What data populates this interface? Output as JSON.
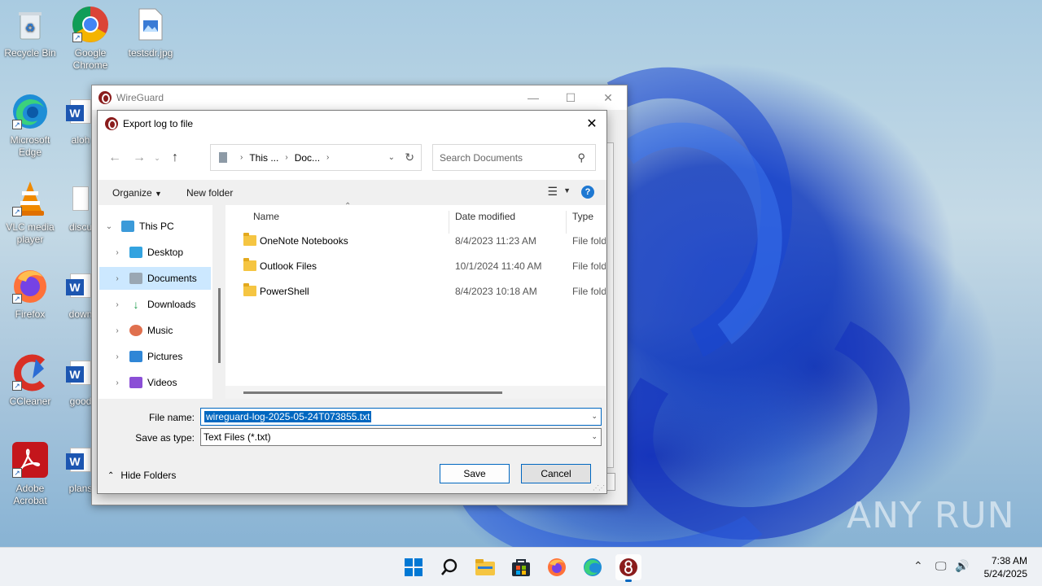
{
  "desktop": {
    "icons": [
      {
        "label": "Recycle Bin",
        "icon": "recycle-bin-icon"
      },
      {
        "label": "Google Chrome",
        "icon": "chrome-icon"
      },
      {
        "label": "testsdr.jpg",
        "icon": "image-file-icon"
      },
      {
        "label": "Microsoft Edge",
        "icon": "edge-icon"
      },
      {
        "label": "aloh",
        "icon": "word-doc-icon"
      },
      {
        "label": "VLC media player",
        "icon": "vlc-icon"
      },
      {
        "label": "discu",
        "icon": "word-doc-icon"
      },
      {
        "label": "Firefox",
        "icon": "firefox-icon"
      },
      {
        "label": "down",
        "icon": "word-doc-icon"
      },
      {
        "label": "CCleaner",
        "icon": "ccleaner-icon"
      },
      {
        "label": "good",
        "icon": "word-doc-icon"
      },
      {
        "label": "Adobe Acrobat",
        "icon": "acrobat-icon"
      },
      {
        "label": "plans",
        "icon": "word-doc-icon"
      }
    ]
  },
  "wireguard_window": {
    "title": "WireGuard"
  },
  "dialog": {
    "title": "Export log to file",
    "address": {
      "crumbs": [
        "This ...",
        "Doc..."
      ]
    },
    "search_placeholder": "Search Documents",
    "toolbar": {
      "organize": "Organize",
      "new_folder": "New folder"
    },
    "tree": [
      {
        "label": "This PC",
        "icon": "pc-icon"
      },
      {
        "label": "Desktop",
        "icon": "desktop-folder-icon"
      },
      {
        "label": "Documents",
        "icon": "documents-folder-icon",
        "selected": true
      },
      {
        "label": "Downloads",
        "icon": "downloads-folder-icon"
      },
      {
        "label": "Music",
        "icon": "music-folder-icon"
      },
      {
        "label": "Pictures",
        "icon": "pictures-folder-icon"
      },
      {
        "label": "Videos",
        "icon": "videos-folder-icon"
      }
    ],
    "columns": {
      "name": "Name",
      "date": "Date modified",
      "type": "Type"
    },
    "files": [
      {
        "name": "OneNote Notebooks",
        "date": "8/4/2023 11:23 AM",
        "type": "File folder"
      },
      {
        "name": "Outlook Files",
        "date": "10/1/2024 11:40 AM",
        "type": "File folder"
      },
      {
        "name": "PowerShell",
        "date": "8/4/2023 10:18 AM",
        "type": "File folder"
      }
    ],
    "file_name_label": "File name:",
    "file_name_value": "wireguard-log-2025-05-24T073855.txt",
    "save_type_label": "Save as type:",
    "save_type_value": "Text Files (*.txt)",
    "hide_folders": "Hide Folders",
    "save_button": "Save",
    "cancel_button": "Cancel"
  },
  "taskbar": {
    "time": "7:38 AM",
    "date": "5/24/2025"
  },
  "watermark": "ANY RUN"
}
